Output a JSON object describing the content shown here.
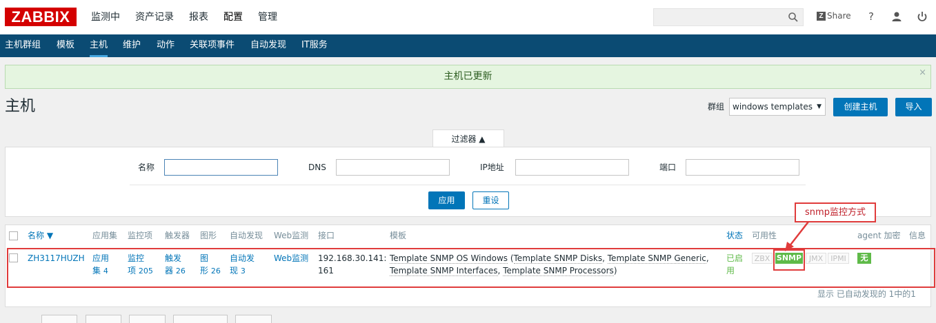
{
  "app": {
    "logo": "ZABBIX"
  },
  "main_menu": [
    "监测中",
    "资产记录",
    "报表",
    "配置",
    "管理"
  ],
  "header": {
    "share_label": "Share",
    "help_icon": "?"
  },
  "sub_menu": [
    "主机群组",
    "模板",
    "主机",
    "维护",
    "动作",
    "关联项事件",
    "自动发现",
    "IT服务"
  ],
  "message": {
    "text": "主机已更新",
    "close": "×"
  },
  "page": {
    "title": "主机",
    "group_label": "群组",
    "group_value": "windows templates",
    "create_button": "创建主机",
    "import_button": "导入"
  },
  "filter": {
    "tab_label": "过滤器 ▲",
    "name_label": "名称",
    "dns_label": "DNS",
    "ip_label": "IP地址",
    "port_label": "端口",
    "name_value": "",
    "dns_value": "",
    "ip_value": "",
    "port_value": "",
    "apply_button": "应用",
    "reset_button": "重设"
  },
  "table": {
    "headers": {
      "name": "名称 ▼",
      "apps": "应用集",
      "items": "监控项",
      "triggers": "触发器",
      "graphs": "图形",
      "discovery": "自动发现",
      "web": "Web监测",
      "interface": "接口",
      "templates": "模板",
      "status": "状态",
      "availability": "可用性",
      "agent_encryption": "agent 加密",
      "info": "信息"
    },
    "rows": [
      {
        "name": "ZH3117HUZH",
        "apps_1": "应用",
        "apps_2": "集",
        "apps_count": "4",
        "items_1": "监控",
        "items_2": "项",
        "items_count": "205",
        "triggers_1": "触发",
        "triggers_2": "器",
        "triggers_count": "26",
        "graphs_1": "图",
        "graphs_2": "形",
        "graphs_count": "26",
        "discovery_1": "自动发",
        "discovery_2": "现",
        "discovery_count": "3",
        "web": "Web监测",
        "interface_1": "192.168.30.141:",
        "interface_2": "161",
        "template_main": "Template SNMP OS Windows",
        "template_paren_open": " (",
        "template_sub_1": "Template SNMP Disks",
        "template_sep_1": ", ",
        "template_sub_2": "Template SNMP Generic",
        "template_sep_2": ",",
        "template_sub_3": "Template SNMP Interfaces",
        "template_sep_3": ", ",
        "template_sub_4": "Template SNMP Processors",
        "template_paren_close": ")",
        "status_1": "已启",
        "status_2": "用",
        "avail_zbx": "ZBX",
        "avail_snmp": "SNMP",
        "avail_jmx": "JMX",
        "avail_ipmi": "IPMI",
        "encryption": "无"
      }
    ],
    "footer": "显示 已自动发现的 1中的1"
  },
  "annotation": {
    "label": "snmp监控方式"
  },
  "colors": {
    "brand": "#d40000",
    "nav": "#0b4b73",
    "accent": "#0275b8",
    "ok": "#5fba49",
    "annotation": "#e03b3b"
  }
}
